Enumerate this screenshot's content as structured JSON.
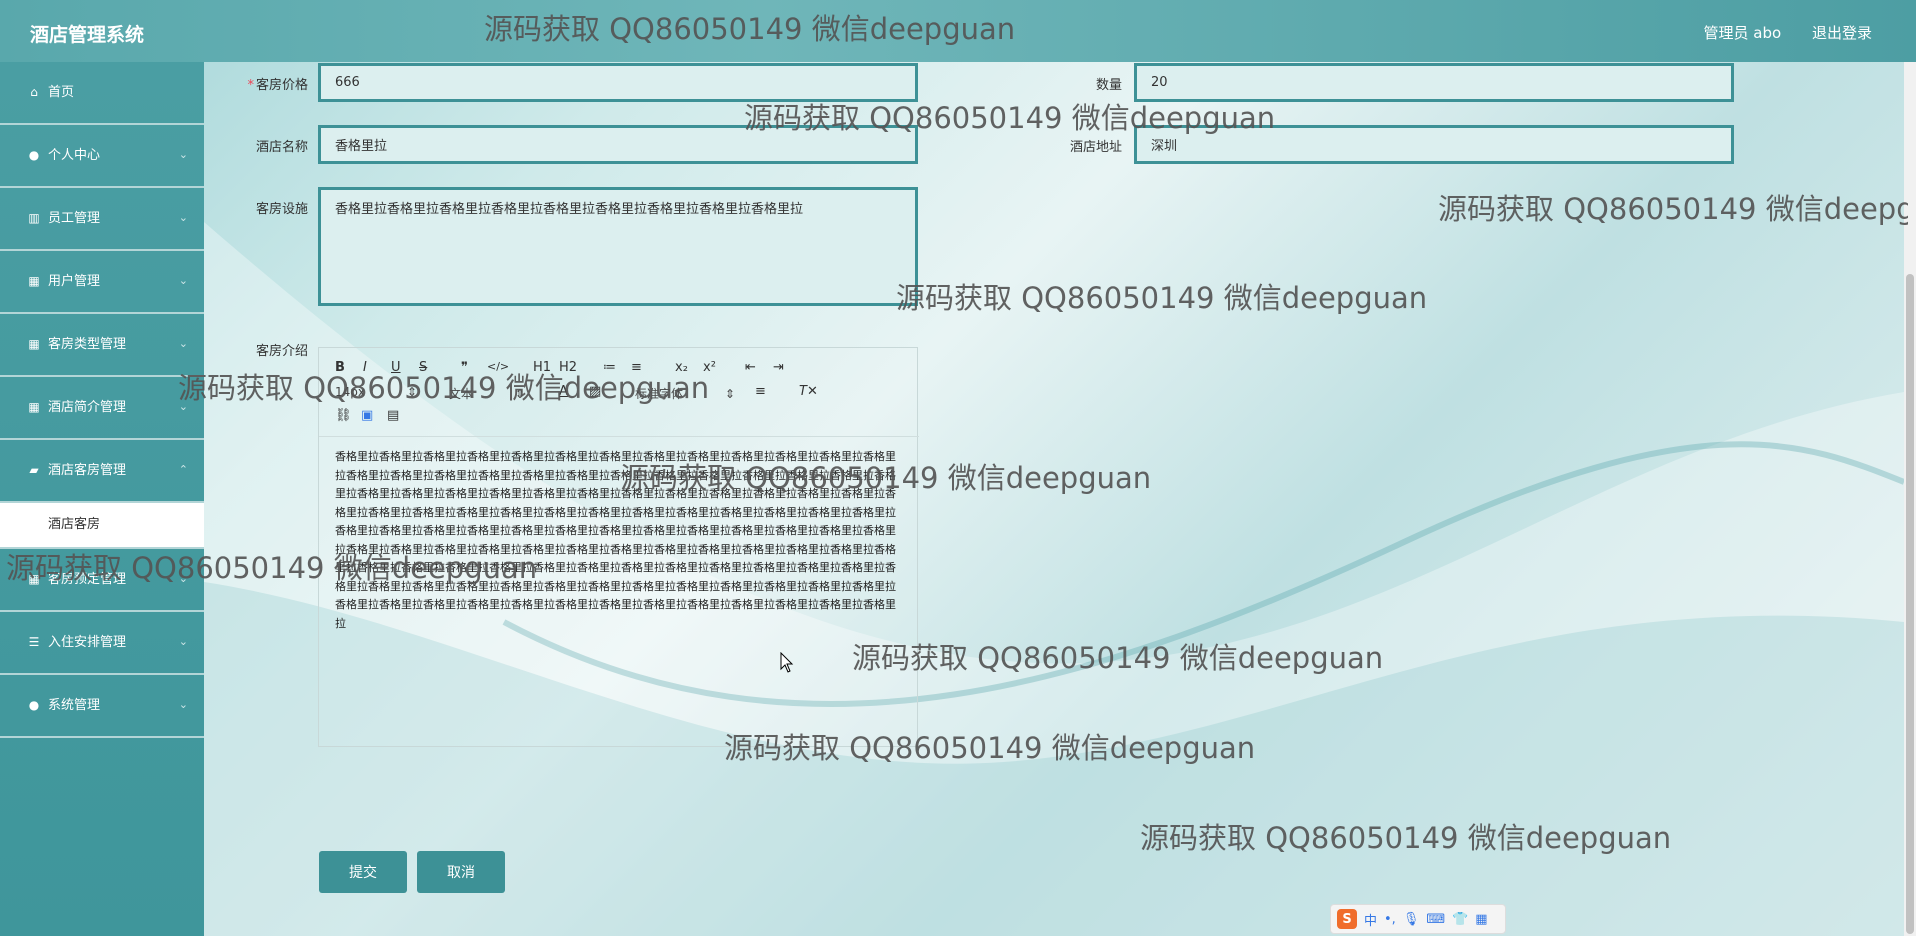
{
  "header": {
    "app_title": "酒店管理系统",
    "user_label": "管理员 abo",
    "logout_label": "退出登录"
  },
  "sidebar": {
    "items": [
      {
        "label": "首页",
        "icon": "home-icon",
        "chevron": false
      },
      {
        "label": "个人中心",
        "icon": "user-icon",
        "chevron": true
      },
      {
        "label": "员工管理",
        "icon": "chart-icon",
        "chevron": true
      },
      {
        "label": "用户管理",
        "icon": "grid-icon",
        "chevron": true
      },
      {
        "label": "客房类型管理",
        "icon": "grid-icon",
        "chevron": true
      },
      {
        "label": "酒店简介管理",
        "icon": "grid-icon",
        "chevron": true
      },
      {
        "label": "酒店客房管理",
        "icon": "comment-icon",
        "chevron": true
      },
      {
        "label": "客房预定管理",
        "icon": "grid-icon",
        "chevron": true
      },
      {
        "label": "入住安排管理",
        "icon": "sliders-icon",
        "chevron": true
      },
      {
        "label": "系统管理",
        "icon": "user-icon",
        "chevron": true
      }
    ],
    "active_subitem": "酒店客房"
  },
  "form": {
    "price_label": "客房价格",
    "price_value": "666",
    "quantity_label": "数量",
    "quantity_value": "20",
    "hotel_name_label": "酒店名称",
    "hotel_name_value": "香格里拉",
    "hotel_address_label": "酒店地址",
    "hotel_address_value": "深圳",
    "facilities_label": "客房设施",
    "facilities_value": "香格里拉香格里拉香格里拉香格里拉香格里拉香格里拉香格里拉香格里拉香格里拉",
    "intro_label": "客房介绍",
    "submit_label": "提交",
    "cancel_label": "取消"
  },
  "editor": {
    "toolbar_row1": [
      "B",
      "I",
      "U",
      "S",
      "❞",
      "</>",
      "H1",
      "H2",
      "≔",
      "≡",
      "x₂",
      "x²",
      "⇤",
      "⇥"
    ],
    "font_size": "14px",
    "text_type": "文本",
    "font_family": "标准字体",
    "content": "香格里拉香格里拉香格里拉香格里拉香格里拉香格里拉香格里拉香格里拉香格里拉香格里拉香格里拉香格里拉香格里拉香格里拉香格里拉香格里拉香格里拉香格里拉香格里拉香格里拉香格里拉香格里拉香格里拉香格里拉香格里拉香格里拉香格里拉香格里拉香格里拉香格里拉香格里拉香格里拉香格里拉香格里拉香格里拉香格里拉香格里拉香格里拉香格里拉香格里拉香格里拉香格里拉香格里拉香格里拉香格里拉香格里拉香格里拉香格里拉香格里拉香格里拉香格里拉香格里拉香格里拉香格里拉香格里拉香格里拉香格里拉香格里拉香格里拉香格里拉香格里拉香格里拉香格里拉香格里拉香格里拉香格里拉香格里拉香格里拉香格里拉香格里拉香格里拉香格里拉香格里拉香格里拉香格里拉香格里拉香格里拉香格里拉香格里拉香格里拉香格里拉香格里拉香格里拉香格里拉香格里拉香格里拉香格里拉香格里拉香格里拉香格里拉香格里拉香格里拉香格里拉香格里拉香格里拉香格里拉香格里拉香格里拉香格里拉香格里拉香格里拉香格里拉香格里拉香格里拉香格里拉香格里拉香格里拉香格里拉香格里拉香格里拉香格里拉香格里拉香格里拉香格里拉香格里拉"
  },
  "watermark_text": "源码获取 QQ86050149 微信deepguan",
  "ime": {
    "label": "中"
  },
  "colors": {
    "accent": "#3d9196",
    "sidebar": "#4a9ea3",
    "topbar": "#59a8ac"
  }
}
